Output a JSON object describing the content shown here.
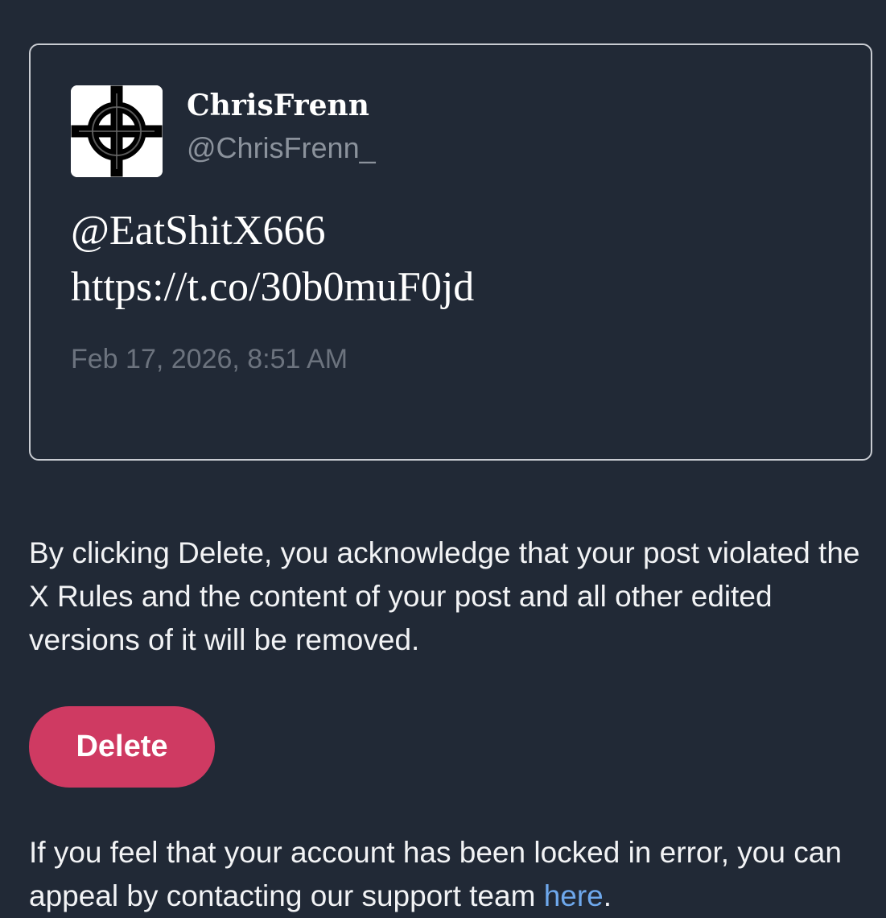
{
  "post": {
    "display_name": "ChrisFrenn",
    "handle": "@ChrisFrenn_",
    "text_lines": [
      "@EatShitX666",
      "https://t.co/30b0muF0jd"
    ],
    "date": "Feb 17, 2026, 8:51 AM",
    "avatar_icon": "celtic-cross-icon"
  },
  "notice": {
    "text": "By clicking Delete, you acknowledge that your post violated the X Rules and the content of your post and all other edited versions of it will be removed."
  },
  "actions": {
    "delete_label": "Delete"
  },
  "appeal": {
    "text_before": "If you feel that your account has been locked in error, you can appeal by contacting our support team ",
    "link_label": "here",
    "text_after": "."
  },
  "colors": {
    "background": "#212936",
    "delete_button": "#cf3a62",
    "link": "#6ea8ec",
    "card_border": "#c9ccd2",
    "muted_text": "#8b929c"
  }
}
